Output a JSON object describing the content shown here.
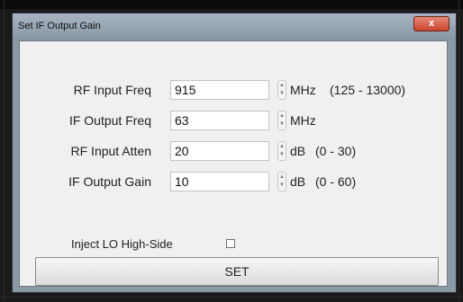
{
  "window": {
    "title": "Set IF Output Gain",
    "close_label": "x"
  },
  "fields": [
    {
      "label": "RF Input Freq",
      "value": "915",
      "unit": "MHz",
      "range": "(125 - 13000)"
    },
    {
      "label": "IF Output Freq",
      "value": "63",
      "unit": "MHz",
      "range": ""
    },
    {
      "label": "RF Input Atten",
      "value": "20",
      "unit": "dB",
      "range": "(0 - 30)"
    },
    {
      "label": "IF Output Gain",
      "value": "10",
      "unit": "dB",
      "range": "(0 - 60)"
    }
  ],
  "inject_lo": {
    "label": "Inject LO High-Side",
    "checked": false
  },
  "set_button": {
    "label": "SET"
  },
  "colors": {
    "window_frame": "#8b98a6",
    "client_bg": "#f0f0f0",
    "close_button": "#c9432d"
  },
  "icons": {
    "spinner_up": "spinner-up-icon",
    "spinner_down": "spinner-down-icon",
    "close": "close-icon"
  }
}
